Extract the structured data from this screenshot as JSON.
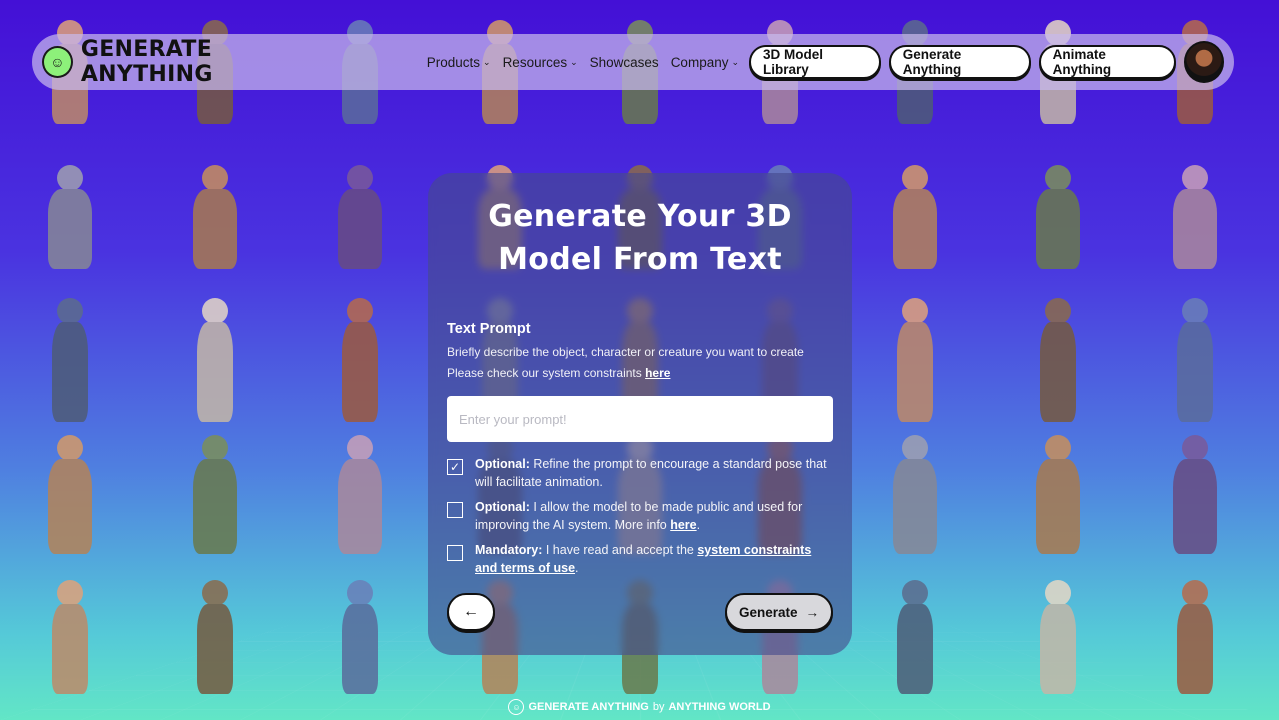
{
  "nav": {
    "brand": "GENERATE ANYTHING",
    "menu": [
      {
        "label": "Products",
        "has_dropdown": true
      },
      {
        "label": "Resources",
        "has_dropdown": true
      },
      {
        "label": "Showcases",
        "has_dropdown": false
      },
      {
        "label": "Company",
        "has_dropdown": true
      }
    ],
    "pills": [
      "3D Model Library",
      "Generate Anything",
      "Animate Anything"
    ],
    "chevron_glyph": "⌄"
  },
  "card": {
    "title": "Generate Your 3D Model From Text",
    "prompt_label": "Text Prompt",
    "help_line1": "Briefly describe the object, character or creature you want to create",
    "help_line2_prefix": "Please check our system constraints ",
    "help_line2_link": "here",
    "prompt_placeholder": "Enter your prompt!",
    "prompt_value": "",
    "options": [
      {
        "checked": true,
        "tag": "Optional:",
        "text": " Refine the prompt to encourage a standard pose that will facilitate animation.",
        "link": "",
        "suffix": ""
      },
      {
        "checked": false,
        "tag": "Optional:",
        "text": " I allow the model to be made public and used for improving the AI system. More info ",
        "link": "here",
        "suffix": "."
      },
      {
        "checked": false,
        "tag": "Mandatory:",
        "text": " I have read and accept the ",
        "link": "system constraints and terms of use",
        "suffix": "."
      }
    ],
    "generate_label": "Generate",
    "check_glyph": "✓",
    "back_glyph": "←",
    "forward_glyph": "→"
  },
  "footer": {
    "left": "GENERATE ANYTHING",
    "by": "by",
    "right": "ANYTHING WORLD"
  },
  "colors": {
    "accent_green": "#8df07a",
    "bg_top": "#4410d6",
    "bg_bottom": "#62e6c6"
  }
}
